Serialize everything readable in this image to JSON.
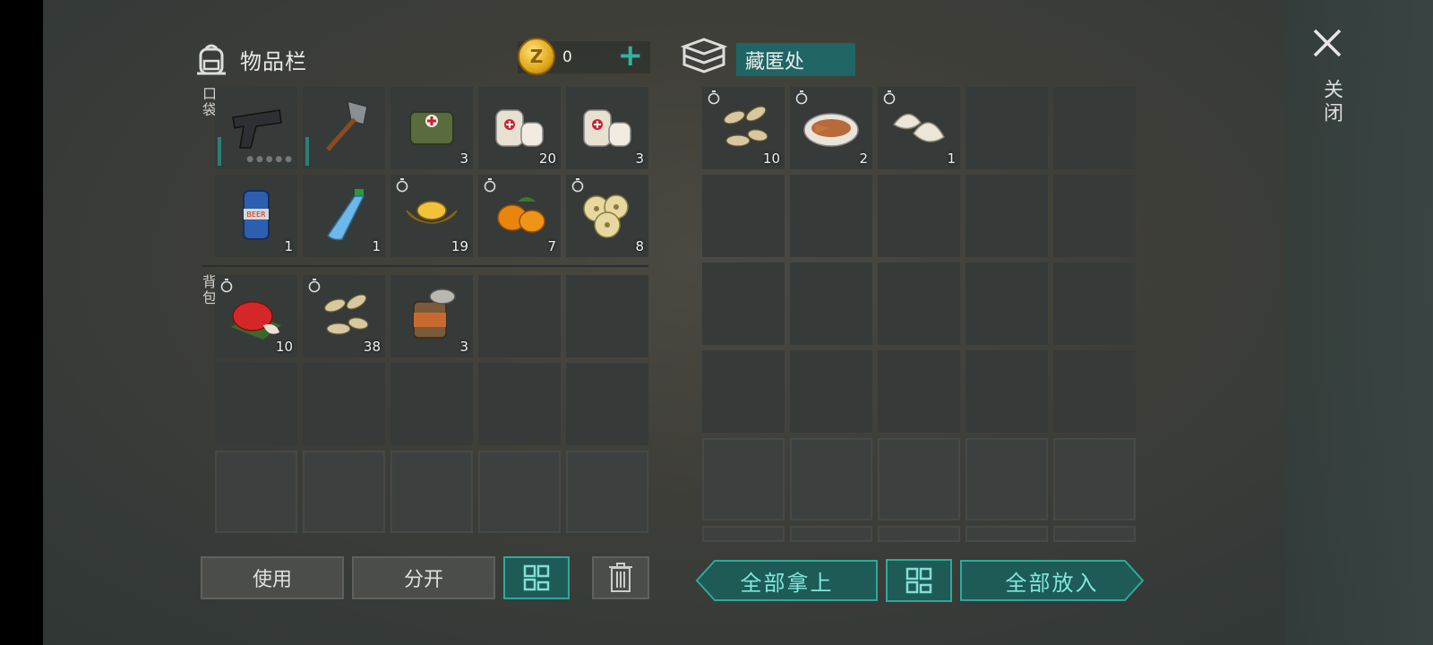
{
  "inventory": {
    "title": "物品栏",
    "coins": "0",
    "pocket_label": "口袋",
    "backpack_label": "背包",
    "pocket_items": [
      {
        "name": "pistol",
        "count": ""
      },
      {
        "name": "shovel",
        "count": ""
      },
      {
        "name": "medkit-bag",
        "count": "3"
      },
      {
        "name": "bandage",
        "count": "20"
      },
      {
        "name": "bandage",
        "count": "3"
      },
      {
        "name": "beer-can",
        "count": "1"
      },
      {
        "name": "water-bottle",
        "count": "1"
      },
      {
        "name": "gold-ingot",
        "count": "19"
      },
      {
        "name": "kumquat",
        "count": "7"
      },
      {
        "name": "lotus-root",
        "count": "8"
      }
    ],
    "backpack_items": [
      {
        "name": "red-cake",
        "count": "10"
      },
      {
        "name": "seeds",
        "count": "38"
      },
      {
        "name": "canned-food",
        "count": "3"
      }
    ],
    "buttons": {
      "use": "使用",
      "split": "分开"
    }
  },
  "stash": {
    "title": "藏匿处",
    "items": [
      {
        "name": "seeds",
        "count": "10"
      },
      {
        "name": "steamed-fish",
        "count": "2"
      },
      {
        "name": "dumplings",
        "count": "1"
      }
    ],
    "buttons": {
      "take_all": "全部拿上",
      "put_all": "全部放入"
    }
  },
  "close_label": "关闭",
  "colors": {
    "accent": "#2fa99c",
    "slot": "#363b39",
    "teal_fill": "#1e5a56"
  }
}
